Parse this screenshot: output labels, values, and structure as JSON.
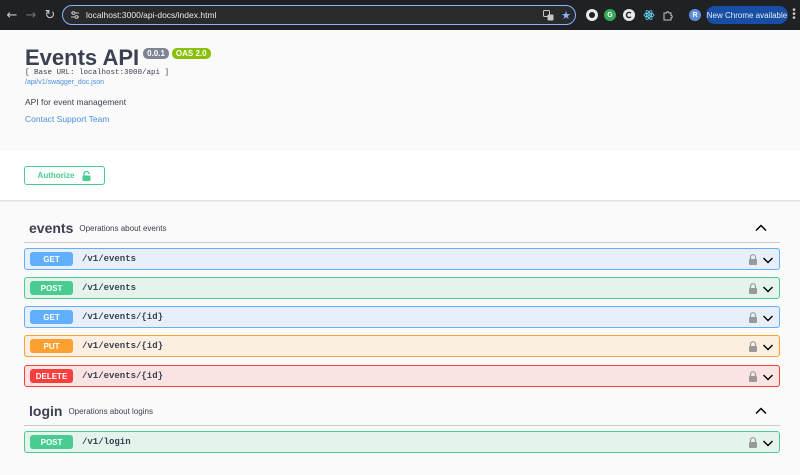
{
  "browser": {
    "url": "localhost:3000/api-docs/index.html",
    "update_label": "New Chrome available",
    "profile_initial": "R",
    "ext_g_initial": "G"
  },
  "info": {
    "title": "Events API",
    "version": "0.0.1",
    "oas": "OAS 2.0",
    "base_url": "[ Base URL: localhost:3000/api ]",
    "doc_link": "/api/v1/swagger_doc.json",
    "description": "API for event management",
    "contact": "Contact Support Team"
  },
  "authorize": {
    "label": "Authorize"
  },
  "tags": [
    {
      "name": "events",
      "description": "Operations about events",
      "operations": [
        {
          "method": "GET",
          "path": "/v1/events"
        },
        {
          "method": "POST",
          "path": "/v1/events"
        },
        {
          "method": "GET",
          "path": "/v1/events/{id}"
        },
        {
          "method": "PUT",
          "path": "/v1/events/{id}"
        },
        {
          "method": "DELETE",
          "path": "/v1/events/{id}"
        }
      ]
    },
    {
      "name": "login",
      "description": "Operations about logins",
      "operations": [
        {
          "method": "POST",
          "path": "/v1/login"
        }
      ]
    }
  ],
  "colors": {
    "get": "#61affe",
    "post": "#49cc90",
    "put": "#fca130",
    "delete": "#f93e3e",
    "link": "#4990e2",
    "text": "#3b4151"
  }
}
